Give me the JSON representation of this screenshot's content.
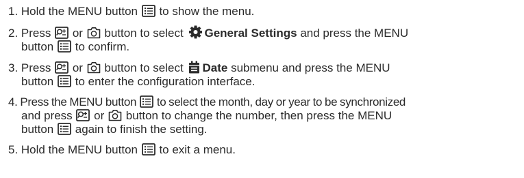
{
  "icons": {
    "menu": "menu-list-icon",
    "zoom": "zoom-plus-minus-icon",
    "camera": "camera-icon",
    "gear": "gear-icon",
    "date": "date-calendar-icon"
  },
  "colors": {
    "text": "#2b2b2b",
    "icon": "#2b2b2b"
  },
  "steps": {
    "s1": {
      "a": "1. Hold the MENU button",
      "b": "to show the menu."
    },
    "s2": {
      "a": "2. Press",
      "or": "or",
      "b": "button to select",
      "bold": "General Settings",
      "c": "and press the MENU",
      "d": "button",
      "e": "to confirm."
    },
    "s3": {
      "a": "3. Press",
      "or": "or",
      "b": "button to select",
      "bold": "Date",
      "c": "submenu and press the MENU",
      "d": "button",
      "e": "to enter the configuration interface."
    },
    "s4": {
      "a": "4. Press the MENU button",
      "b": "to select the month, day or year to be synchronized",
      "c": "and press",
      "or": "or",
      "d": "button to change the number, then press the MENU",
      "e": "button",
      "f": "again to finish the setting."
    },
    "s5": {
      "a": "5. Hold the MENU button",
      "b": "to exit a menu."
    }
  }
}
